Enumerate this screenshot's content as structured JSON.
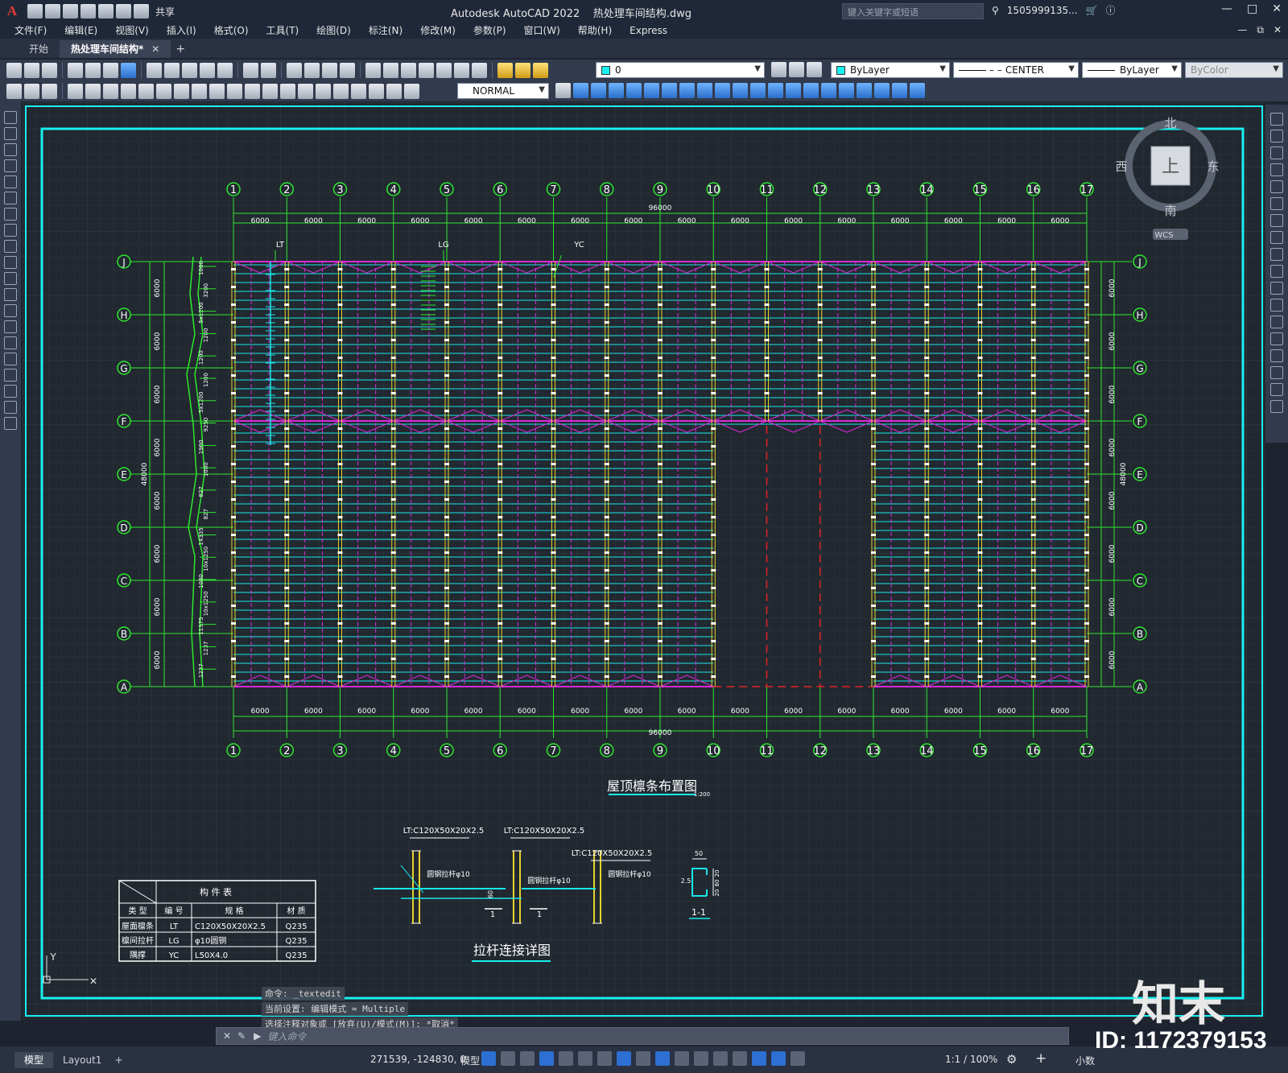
{
  "titlebar": {
    "app_title": "Autodesk AutoCAD 2022",
    "file_name": "热处理车间结构.dwg",
    "share_label": "共享",
    "search_placeholder": "键入关键字或短语",
    "user_label": "1505999135...",
    "logo_letter": "A"
  },
  "menu": [
    "文件(F)",
    "编辑(E)",
    "视图(V)",
    "插入(I)",
    "格式(O)",
    "工具(T)",
    "绘图(D)",
    "标注(N)",
    "修改(M)",
    "参数(P)",
    "窗口(W)",
    "帮助(H)",
    "Express"
  ],
  "tabs": {
    "start": "开始",
    "active": "热处理车间结构*"
  },
  "toolbar": {
    "layer_value": "0",
    "textstyle_value": "NORMAL",
    "color_value": "ByLayer",
    "linetype_value": "CENTER",
    "lineweight_value": "ByLayer",
    "plotstyle_value": "ByColor"
  },
  "viewcube": {
    "north": "北",
    "south": "南",
    "east": "东",
    "west": "西",
    "top": "上",
    "wcs": "WCS"
  },
  "drawing": {
    "grid_numbers": [
      "1",
      "2",
      "3",
      "4",
      "5",
      "6",
      "7",
      "8",
      "9",
      "10",
      "11",
      "12",
      "13",
      "14",
      "15",
      "16",
      "17"
    ],
    "grid_letters": [
      "J",
      "H",
      "G",
      "F",
      "E",
      "D",
      "C",
      "B",
      "A"
    ],
    "bay_dim": "6000",
    "total_width": "96000",
    "total_depth": "48000",
    "labels": {
      "lt": "LT",
      "lg": "LG",
      "yc": "YC"
    },
    "left_annotations": [
      "1080",
      "3200",
      "5x1200",
      "1200",
      "1200",
      "1200",
      "5x1200",
      "9250",
      "1900",
      "1080",
      "827",
      "827",
      "14335",
      "10x1250",
      "1080",
      "10x1250",
      "11375",
      "1237",
      "1237"
    ],
    "plan_title": "屋顶檩条布置图",
    "plan_scale": "1:200",
    "detail_title": "拉杆连接详图",
    "detail_labels": [
      "LT:C120X50X20X2.5",
      "LT:C120X50X20X2.5",
      "LT:C120X50X20X2.5",
      "圆钢拉杆φ10",
      "圆钢拉杆φ10",
      "圆钢拉杆φ10",
      "60",
      "1",
      "1"
    ],
    "section": {
      "title": "1-1",
      "dims": [
        "50",
        "2.5",
        "20",
        "80",
        "20"
      ]
    }
  },
  "component_table": {
    "title": "构 件 表",
    "headers": [
      "类 型",
      "编 号",
      "规 格",
      "材 质"
    ],
    "rows": [
      [
        "屋面檩条",
        "LT",
        "C120X50X20X2.5",
        "Q235"
      ],
      [
        "檩间拉杆",
        "LG",
        "φ10圆钢",
        "Q235"
      ],
      [
        "隅撑",
        "YC",
        "L50X4.0",
        "Q235"
      ]
    ]
  },
  "command": {
    "history": [
      "命令: _textedit",
      "当前设置: 编辑模式 = Multiple",
      "选择注释对象或 [放弃(U)/模式(M)]: *取消*"
    ],
    "placeholder": "键入命令"
  },
  "status": {
    "model_tab": "模型",
    "layout_tab": "Layout1",
    "coords": "271539, -124830, 0",
    "mode_label": "模型",
    "scale": "1:1 / 100%",
    "units": "小数"
  },
  "watermark": {
    "id": "ID: 1172379153",
    "logo": "知末"
  },
  "colors": {
    "canvas": "#212830",
    "frame": "#19f0f0",
    "grid_line": "#2ee82e",
    "purlin": "#19e8e8",
    "brace": "#d82bd8",
    "column": "#e8d22a"
  }
}
